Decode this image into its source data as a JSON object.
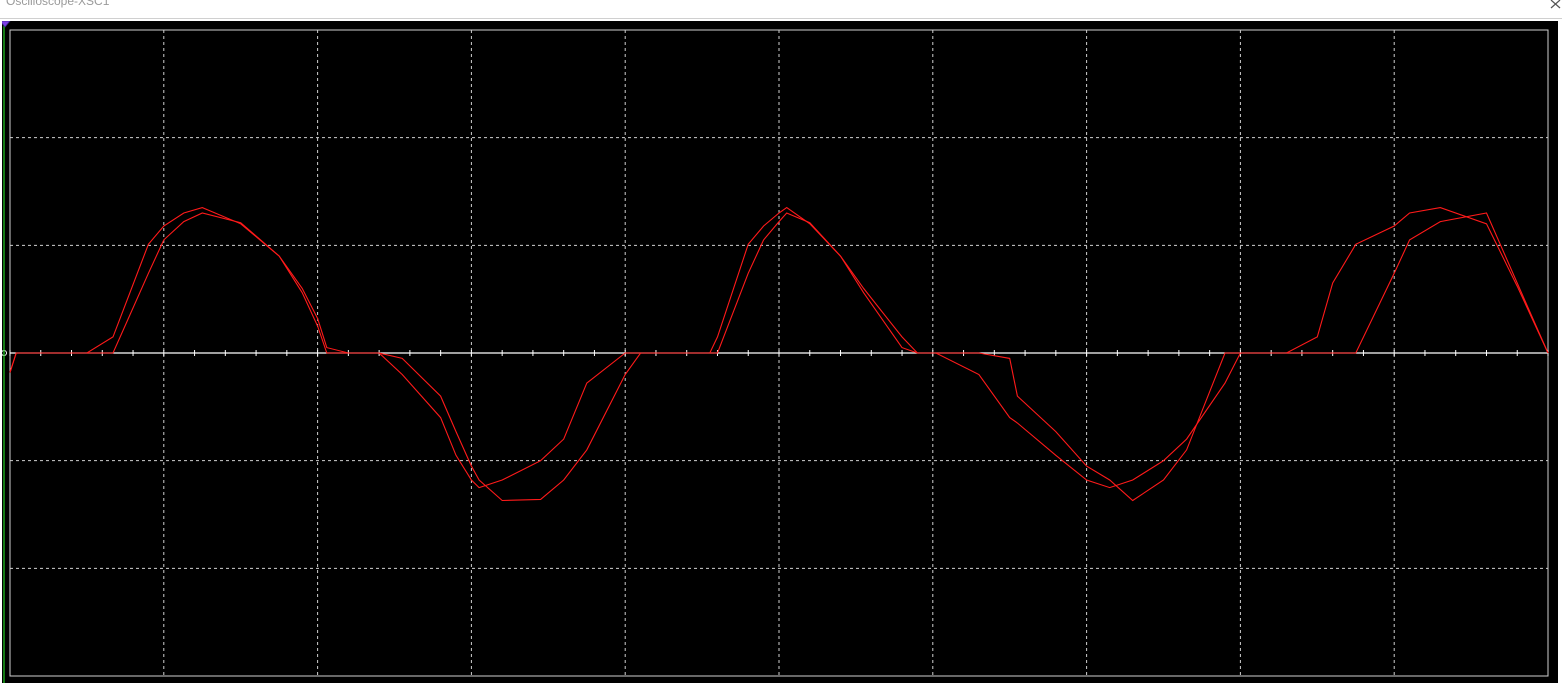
{
  "window": {
    "title": "Oscilloscope-XSC1"
  },
  "icons": {
    "close": "close-icon",
    "trigger_marker": "trigger-marker-icon"
  },
  "colors": {
    "screen_background": "#000000",
    "grid": "#cfcfcf",
    "axis": "#ffffff",
    "trace": "#ff1a1a",
    "cursor": "#22cc22",
    "trigger_marker": "#7b3fe4"
  },
  "chart_data": {
    "type": "line",
    "grid": true,
    "x_divisions": 10,
    "y_divisions": 6,
    "x": [
      0.0,
      0.04,
      0.2,
      0.25,
      0.5,
      0.67,
      0.9,
      1.0,
      1.13,
      1.25,
      1.5,
      1.75,
      1.9,
      2.0,
      2.06,
      2.2,
      2.4,
      2.55,
      2.8,
      2.9,
      3.0,
      3.05,
      3.2,
      3.45,
      3.6,
      3.75,
      4.0,
      4.1,
      4.2,
      4.3,
      4.4,
      4.55,
      4.6,
      4.8,
      4.9,
      5.0,
      5.05,
      5.2,
      5.4,
      5.55,
      5.8,
      5.9,
      6.0,
      6.02,
      6.3,
      6.5,
      6.55,
      6.8,
      7.0,
      7.15,
      7.3,
      7.5,
      7.65,
      7.9,
      8.0,
      8.13,
      8.3,
      8.5,
      8.6,
      8.75,
      9.0,
      9.1,
      9.3,
      9.6,
      9.8,
      10.0
    ],
    "series": [
      {
        "values": [
          -0.18,
          0.0,
          0.0,
          0.0,
          0.0,
          0.0,
          0.74,
          1.05,
          1.22,
          1.3,
          1.21,
          0.9,
          0.6,
          0.32,
          0.05,
          0.0,
          0.0,
          -0.05,
          -0.4,
          -0.73,
          -1.05,
          -1.18,
          -1.37,
          -1.36,
          -1.18,
          -0.9,
          -0.2,
          0.0,
          0.0,
          0.0,
          0.0,
          0.0,
          0.0,
          0.74,
          1.05,
          1.22,
          1.3,
          1.21,
          0.9,
          0.6,
          0.15,
          0.0,
          0.0,
          0.0,
          0.0,
          -0.05,
          -0.4,
          -0.73,
          -1.05,
          -1.18,
          -1.37,
          -1.18,
          -0.9,
          0.0,
          0.0,
          0.0,
          0.0,
          0.0,
          0.0,
          0.0,
          0.74,
          1.05,
          1.22,
          1.3,
          0.65,
          0.0
        ]
      },
      {
        "values": [
          -0.18,
          0.0,
          0.0,
          0.0,
          0.0,
          0.15,
          1.01,
          1.18,
          1.3,
          1.35,
          1.2,
          0.9,
          0.56,
          0.25,
          0.0,
          0.0,
          0.0,
          -0.2,
          -0.6,
          -0.95,
          -1.18,
          -1.25,
          -1.18,
          -1.0,
          -0.8,
          -0.28,
          0.0,
          0.0,
          0.0,
          0.0,
          0.0,
          0.0,
          0.15,
          1.01,
          1.18,
          1.3,
          1.35,
          1.2,
          0.9,
          0.56,
          0.05,
          0.0,
          0.0,
          0.0,
          -0.2,
          -0.6,
          -0.65,
          -0.95,
          -1.18,
          -1.25,
          -1.18,
          -1.0,
          -0.8,
          -0.28,
          0.0,
          0.0,
          0.0,
          0.15,
          0.65,
          1.01,
          1.18,
          1.3,
          1.35,
          1.2,
          0.62,
          0.0
        ]
      }
    ]
  }
}
